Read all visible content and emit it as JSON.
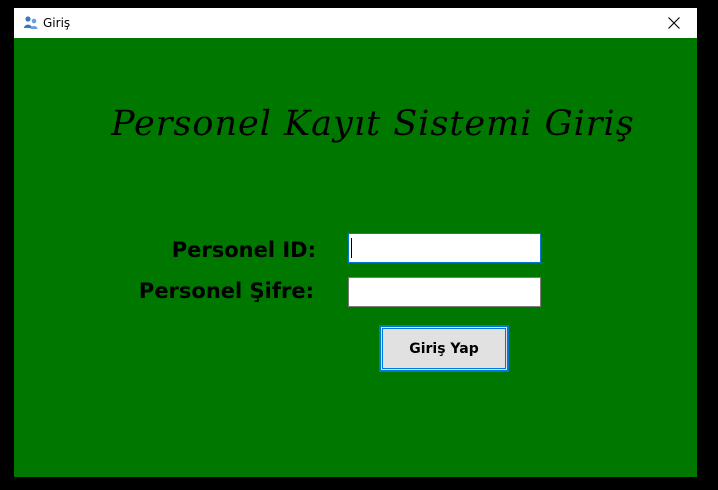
{
  "window": {
    "title": "Giriş",
    "icon": "users-app-icon",
    "close_icon": "close-icon"
  },
  "form": {
    "heading": "Personel Kayıt Sistemi Giriş",
    "id_label": "Personel ID:",
    "id_value": "",
    "password_label": "Personel Şifre:",
    "password_value": "",
    "submit_label": "Giriş Yap"
  },
  "colors": {
    "background": "#007800",
    "accent": "#0078d7"
  }
}
